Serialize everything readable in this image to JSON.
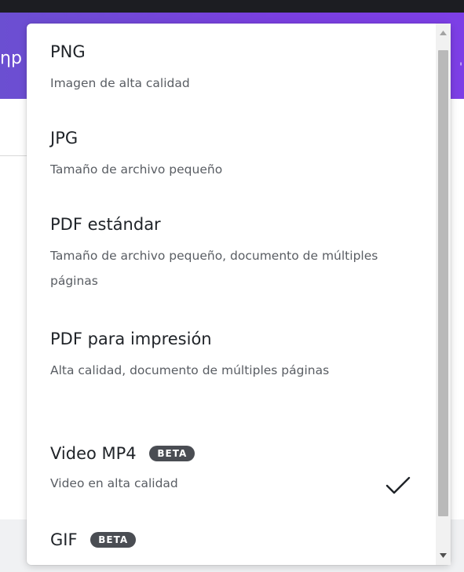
{
  "background": {
    "left_text": "ηp",
    "right_tick": "'"
  },
  "menu": {
    "options": [
      {
        "title": "PNG",
        "description": "Imagen de alta calidad",
        "badge": "",
        "selected": false
      },
      {
        "title": "JPG",
        "description": "Tamaño de archivo pequeño",
        "badge": "",
        "selected": false
      },
      {
        "title": "PDF estándar",
        "description": "Tamaño de archivo pequeño, documento de múltiples páginas",
        "badge": "",
        "selected": false
      },
      {
        "title": "PDF para impresión",
        "description": "Alta calidad, documento de múltiples páginas",
        "badge": "",
        "selected": false
      },
      {
        "title": "Video MP4",
        "description": "Video en alta calidad",
        "badge": "BETA",
        "selected": true
      },
      {
        "title": "GIF",
        "description": "",
        "badge": "BETA",
        "selected": false
      }
    ]
  },
  "colors": {
    "accent": "#7a3fe0",
    "badge_bg": "#4a4d53",
    "title_text": "#1f2328",
    "desc_text": "#595d63"
  },
  "icons": {
    "selected": "checkmark-icon",
    "scroll_up": "scroll-up-arrow-icon",
    "scroll_down": "scroll-down-arrow-icon"
  }
}
